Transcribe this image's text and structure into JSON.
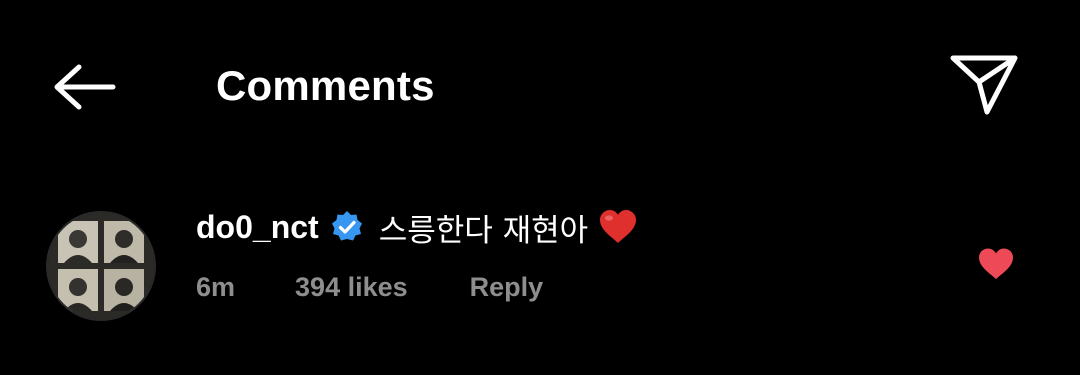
{
  "header": {
    "title": "Comments",
    "back_icon": "arrow-left-icon",
    "share_icon": "paper-plane-icon"
  },
  "comment": {
    "username": "do0_nct",
    "verified": true,
    "text": "스릉한다 재현아",
    "emoji": "❤️",
    "time": "6m",
    "likes": "394 likes",
    "reply": "Reply",
    "liked": true
  },
  "colors": {
    "background": "#000000",
    "text": "#ffffff",
    "muted": "#8e8e8e",
    "verified_blue": "#3797f0",
    "like_red": "#ed4956"
  }
}
